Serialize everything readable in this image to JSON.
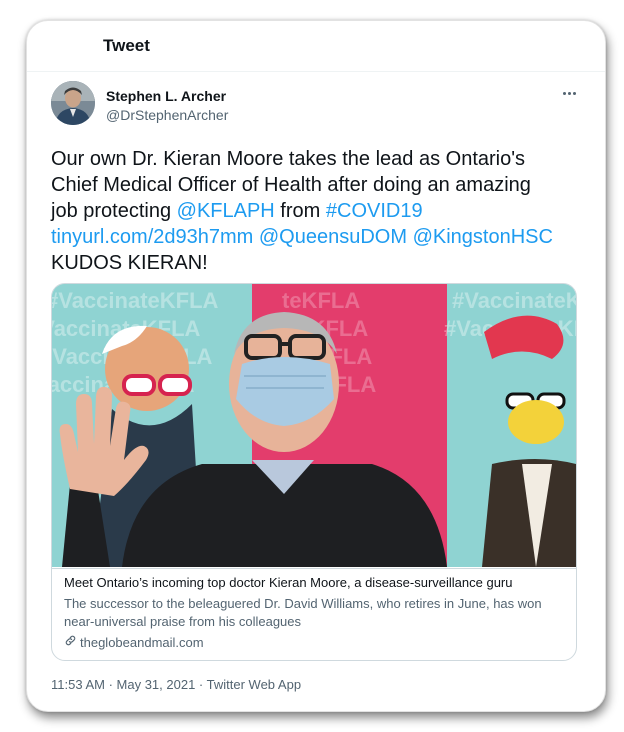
{
  "header": {
    "title": "Tweet"
  },
  "author": {
    "name": "Stephen L. Archer",
    "handle": "@DrStephenArcher"
  },
  "tweet": {
    "line1": "Our own Dr. Kieran Moore takes the lead as Ontario's",
    "line2": "Chief Medical Officer of Health after doing an amazing",
    "line3_prefix": "job protecting ",
    "mention_kflaph": "@KFLAPH",
    "line3_mid": " from ",
    "hashtag_covid": "#COVID19",
    "link_tinyurl": "tinyurl.com/2d93h7mm",
    "mention_queensu": "@QueensuDOM",
    "mention_kingston": "@KingstonHSC",
    "line5": "KUDOS KIERAN!"
  },
  "card": {
    "image_watermark": "#VaccinateKFLA",
    "title": "Meet Ontario’s incoming top doctor Kieran Moore, a disease-surveillance guru",
    "description": "The successor to the beleaguered Dr. David Williams, who retires in June, has won near-universal praise from his colleagues",
    "domain": "theglobeandmail.com"
  },
  "meta": {
    "time": "11:53 AM",
    "date": "May 31, 2021",
    "source": "Twitter Web App",
    "separator": " · "
  },
  "colors": {
    "link": "#1d9bf0",
    "text": "#0f1419",
    "muted": "#536471"
  },
  "icons": [
    "more-icon",
    "link-icon"
  ]
}
